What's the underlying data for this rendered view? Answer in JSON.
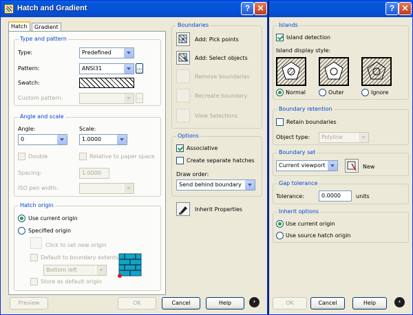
{
  "main_dialog": {
    "title": "Hatch and Gradient",
    "tabs": [
      "Hatch",
      "Gradient"
    ],
    "type_pattern": {
      "group_title": "Type and pattern",
      "type_label": "Type:",
      "type_value": "Predefined",
      "pattern_label": "Pattern:",
      "pattern_value": "ANSI31",
      "pattern_browse": "...",
      "swatch_label": "Swatch:",
      "custom_pattern_label": "Custom pattern:",
      "custom_browse": "..."
    },
    "angle_scale": {
      "group_title": "Angle and scale",
      "angle_label": "Angle:",
      "angle_value": "0",
      "scale_label": "Scale:",
      "scale_value": "1.0000",
      "double_label": "Double",
      "relative_label": "Relative to paper space",
      "spacing_label": "Spacing:",
      "spacing_value": "1.0000",
      "iso_label": "ISO pen width:"
    },
    "hatch_origin": {
      "group_title": "Hatch origin",
      "use_current": "Use current origin",
      "specified": "Specified origin",
      "click_new_origin": "Click to set new origin",
      "default_extents": "Default to boundary extents",
      "extent_value": "Bottom left",
      "store_default": "Store as default origin"
    },
    "boundaries": {
      "group_title": "Boundaries",
      "add_pick": "Add: Pick points",
      "add_select": "Add: Select objects",
      "remove": "Remove boundaries",
      "recreate": "Recreate boundary",
      "view": "View Selections"
    },
    "options": {
      "group_title": "Options",
      "associative": "Associative",
      "separate": "Create separate hatches",
      "draw_order_label": "Draw order:",
      "draw_order_value": "Send behind boundary"
    },
    "inherit": "Inherit Properties",
    "footer": {
      "preview": "Preview",
      "ok": "OK",
      "cancel": "Cancel",
      "help": "Help"
    }
  },
  "more_options": {
    "islands": {
      "group_title": "Islands",
      "island_detection": "Island detection",
      "display_style_label": "Island display style:",
      "normal": "Normal",
      "outer": "Outer",
      "ignore": "Ignore"
    },
    "retention": {
      "group_title": "Boundary retention",
      "retain": "Retain boundaries",
      "object_type_label": "Object type:",
      "object_type_value": "Polyline"
    },
    "boundary_set": {
      "group_title": "Boundary set",
      "value": "Current viewport",
      "new": "New"
    },
    "gap": {
      "group_title": "Gap tolerance",
      "label": "Tolerance:",
      "value": "0.0000",
      "units": "units"
    },
    "inherit_options": {
      "group_title": "Inherit options",
      "use_current": "Use current origin",
      "use_source": "Use source hatch origin"
    },
    "footer": {
      "ok": "OK",
      "cancel": "Cancel",
      "help": "Help"
    }
  },
  "colors": {
    "titlebar": "#0551DB",
    "group_title": "#0046D5",
    "dialog_bg": "#ECE9D8"
  }
}
